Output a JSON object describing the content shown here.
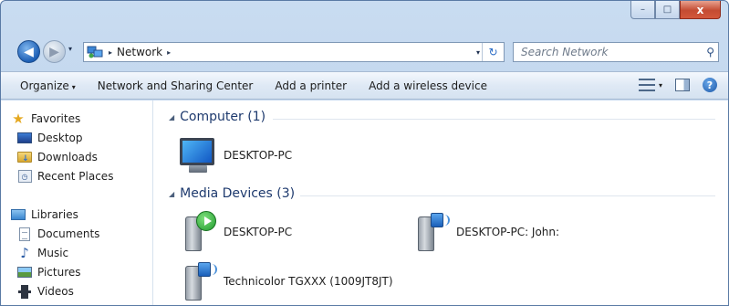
{
  "window": {
    "caption_min": "–",
    "caption_max": "□",
    "caption_close": "x"
  },
  "address_bar": {
    "separator_1": "▸",
    "location": "Network",
    "separator_2": "▸",
    "dropdown": "▾",
    "refresh": "↻"
  },
  "search": {
    "placeholder": "Search Network",
    "icon": "search-icon"
  },
  "toolbar": {
    "organize": "Organize",
    "organize_arrow": "▾",
    "network_sharing": "Network and Sharing Center",
    "add_printer": "Add a printer",
    "add_wireless": "Add a wireless device",
    "view_arrow": "▾",
    "help": "?"
  },
  "sidebar": {
    "favorites": {
      "header": "Favorites",
      "items": [
        {
          "label": "Desktop",
          "icon": "desktop-icon"
        },
        {
          "label": "Downloads",
          "icon": "downloads-icon"
        },
        {
          "label": "Recent Places",
          "icon": "recent-places-icon"
        }
      ]
    },
    "libraries": {
      "header": "Libraries",
      "items": [
        {
          "label": "Documents",
          "icon": "documents-icon"
        },
        {
          "label": "Music",
          "icon": "music-icon"
        },
        {
          "label": "Pictures",
          "icon": "pictures-icon"
        },
        {
          "label": "Videos",
          "icon": "videos-icon"
        }
      ]
    }
  },
  "main": {
    "groups": [
      {
        "header": "Computer (1)",
        "devices": [
          {
            "label": "DESKTOP-PC",
            "icon": "computer-icon"
          }
        ]
      },
      {
        "header": "Media Devices (3)",
        "devices": [
          {
            "label": "DESKTOP-PC",
            "icon": "media-server-icon"
          },
          {
            "label": "DESKTOP-PC: John:",
            "icon": "media-device-icon"
          },
          {
            "label": "Technicolor TGXXX (1009JT8JT)",
            "icon": "media-device-icon"
          }
        ]
      }
    ]
  }
}
